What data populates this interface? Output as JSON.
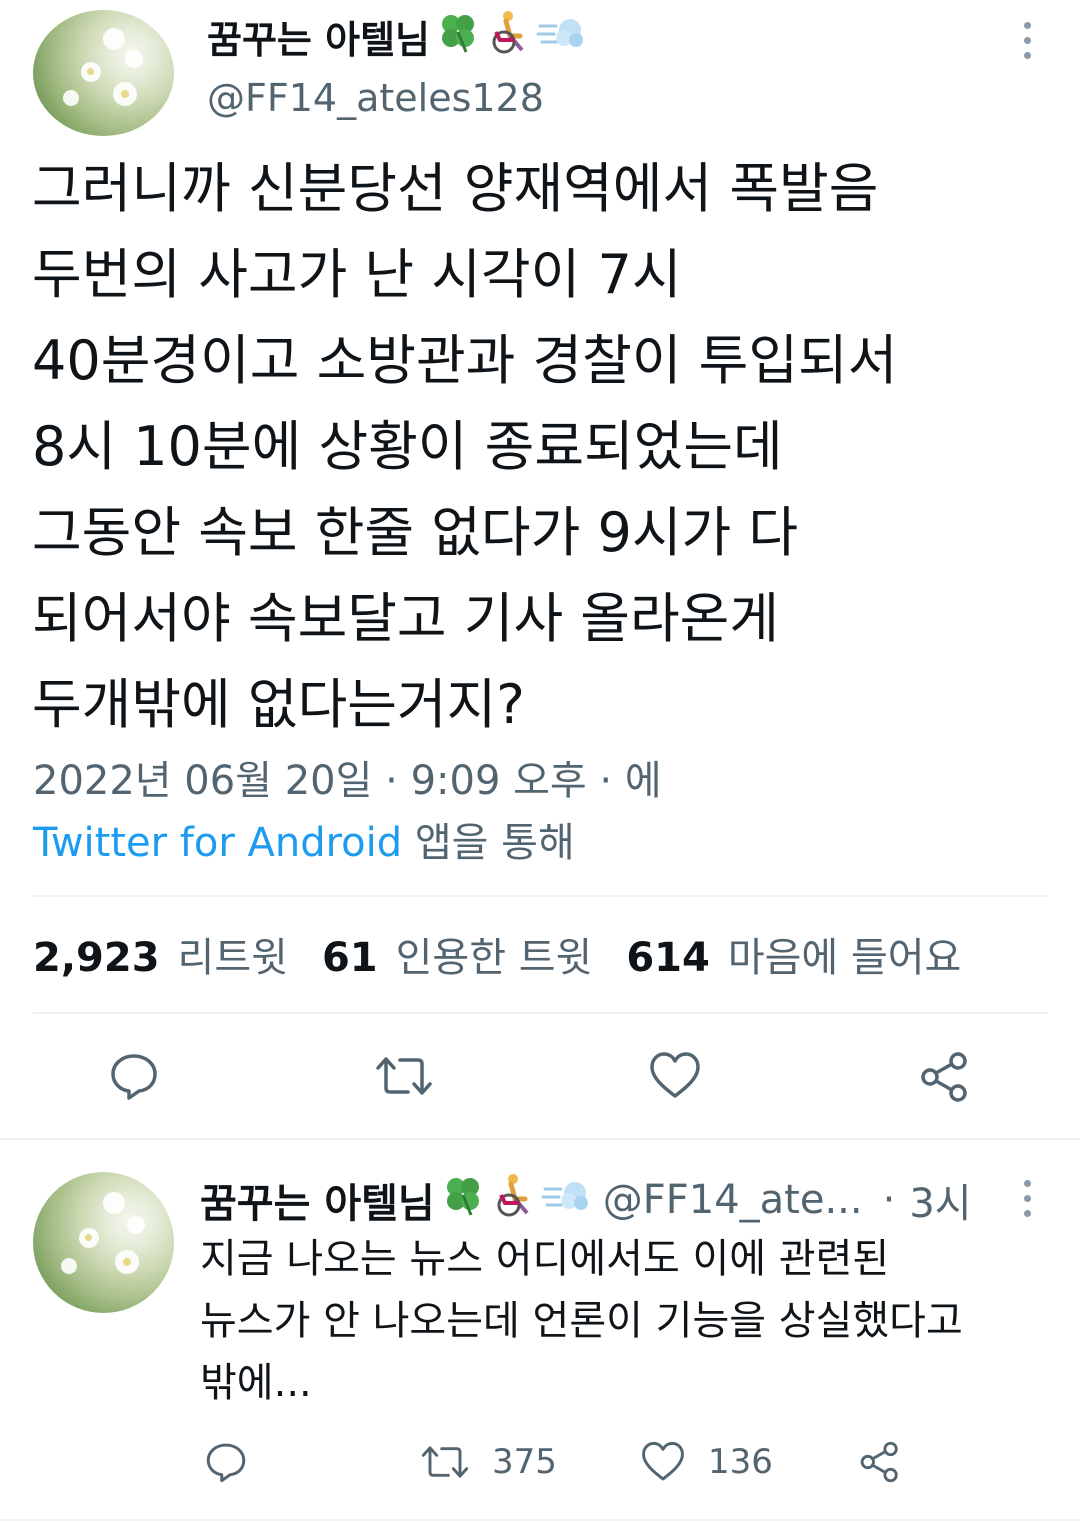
{
  "main_tweet": {
    "author_name": "꿈꾸는 아텔님",
    "author_handle": "@FF14_ateles128",
    "name_emojis": [
      "clover-icon",
      "wheelchair-person-icon",
      "dash-icon"
    ],
    "text_lines": [
      "그러니까 신분당선 양재역에서 폭발음",
      "두번의 사고가 난 시각이 7시",
      "40분경이고 소방관과 경찰이 투입되서",
      "8시 10분에 상황이 종료되었는데",
      "그동안 속보 한줄 없다가 9시가 다",
      "되어서야 속보달고 기사 올라온게",
      "두개밖에 없다는거지?"
    ],
    "timestamp": "2022년 06월 20일 · 9:09 오후 · 에",
    "source_link": "Twitter for Android",
    "source_suffix": " 앱을 통해",
    "stats": {
      "retweets_count": "2,923",
      "retweets_label": "리트윗",
      "quotes_count": "61",
      "quotes_label": "인용한 트윗",
      "likes_count": "614",
      "likes_label": "마음에 들어요"
    }
  },
  "reply_tweet": {
    "author_name": "꿈꾸는 아텔님",
    "author_handle": "@FF14_ate...",
    "separator": "·",
    "time": "3시",
    "text_lines": [
      "지금 나오는 뉴스 어디에서도 이에 관련된",
      "뉴스가 안 나오는데 언론이 기능을 상실했다고",
      "밖에..."
    ],
    "retweet_count": "375",
    "like_count": "136"
  },
  "colors": {
    "text": "#0f1419",
    "secondary": "#536471",
    "link": "#1d9bf0",
    "divider": "#eff3f4"
  }
}
